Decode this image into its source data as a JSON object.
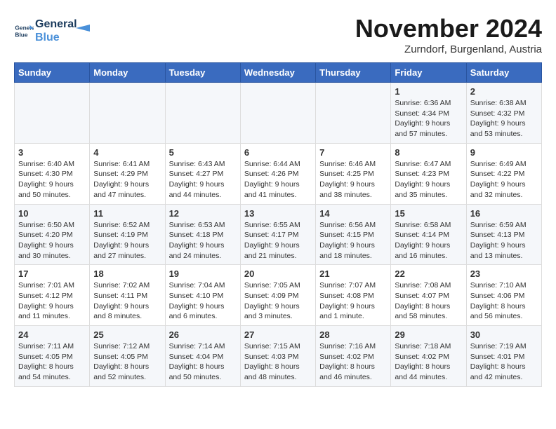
{
  "logo": {
    "line1": "General",
    "line2": "Blue"
  },
  "title": "November 2024",
  "subtitle": "Zurndorf, Burgenland, Austria",
  "days_of_week": [
    "Sunday",
    "Monday",
    "Tuesday",
    "Wednesday",
    "Thursday",
    "Friday",
    "Saturday"
  ],
  "weeks": [
    [
      {
        "day": "",
        "info": ""
      },
      {
        "day": "",
        "info": ""
      },
      {
        "day": "",
        "info": ""
      },
      {
        "day": "",
        "info": ""
      },
      {
        "day": "",
        "info": ""
      },
      {
        "day": "1",
        "info": "Sunrise: 6:36 AM\nSunset: 4:34 PM\nDaylight: 9 hours and 57 minutes."
      },
      {
        "day": "2",
        "info": "Sunrise: 6:38 AM\nSunset: 4:32 PM\nDaylight: 9 hours and 53 minutes."
      }
    ],
    [
      {
        "day": "3",
        "info": "Sunrise: 6:40 AM\nSunset: 4:30 PM\nDaylight: 9 hours and 50 minutes."
      },
      {
        "day": "4",
        "info": "Sunrise: 6:41 AM\nSunset: 4:29 PM\nDaylight: 9 hours and 47 minutes."
      },
      {
        "day": "5",
        "info": "Sunrise: 6:43 AM\nSunset: 4:27 PM\nDaylight: 9 hours and 44 minutes."
      },
      {
        "day": "6",
        "info": "Sunrise: 6:44 AM\nSunset: 4:26 PM\nDaylight: 9 hours and 41 minutes."
      },
      {
        "day": "7",
        "info": "Sunrise: 6:46 AM\nSunset: 4:25 PM\nDaylight: 9 hours and 38 minutes."
      },
      {
        "day": "8",
        "info": "Sunrise: 6:47 AM\nSunset: 4:23 PM\nDaylight: 9 hours and 35 minutes."
      },
      {
        "day": "9",
        "info": "Sunrise: 6:49 AM\nSunset: 4:22 PM\nDaylight: 9 hours and 32 minutes."
      }
    ],
    [
      {
        "day": "10",
        "info": "Sunrise: 6:50 AM\nSunset: 4:20 PM\nDaylight: 9 hours and 30 minutes."
      },
      {
        "day": "11",
        "info": "Sunrise: 6:52 AM\nSunset: 4:19 PM\nDaylight: 9 hours and 27 minutes."
      },
      {
        "day": "12",
        "info": "Sunrise: 6:53 AM\nSunset: 4:18 PM\nDaylight: 9 hours and 24 minutes."
      },
      {
        "day": "13",
        "info": "Sunrise: 6:55 AM\nSunset: 4:17 PM\nDaylight: 9 hours and 21 minutes."
      },
      {
        "day": "14",
        "info": "Sunrise: 6:56 AM\nSunset: 4:15 PM\nDaylight: 9 hours and 18 minutes."
      },
      {
        "day": "15",
        "info": "Sunrise: 6:58 AM\nSunset: 4:14 PM\nDaylight: 9 hours and 16 minutes."
      },
      {
        "day": "16",
        "info": "Sunrise: 6:59 AM\nSunset: 4:13 PM\nDaylight: 9 hours and 13 minutes."
      }
    ],
    [
      {
        "day": "17",
        "info": "Sunrise: 7:01 AM\nSunset: 4:12 PM\nDaylight: 9 hours and 11 minutes."
      },
      {
        "day": "18",
        "info": "Sunrise: 7:02 AM\nSunset: 4:11 PM\nDaylight: 9 hours and 8 minutes."
      },
      {
        "day": "19",
        "info": "Sunrise: 7:04 AM\nSunset: 4:10 PM\nDaylight: 9 hours and 6 minutes."
      },
      {
        "day": "20",
        "info": "Sunrise: 7:05 AM\nSunset: 4:09 PM\nDaylight: 9 hours and 3 minutes."
      },
      {
        "day": "21",
        "info": "Sunrise: 7:07 AM\nSunset: 4:08 PM\nDaylight: 9 hours and 1 minute."
      },
      {
        "day": "22",
        "info": "Sunrise: 7:08 AM\nSunset: 4:07 PM\nDaylight: 8 hours and 58 minutes."
      },
      {
        "day": "23",
        "info": "Sunrise: 7:10 AM\nSunset: 4:06 PM\nDaylight: 8 hours and 56 minutes."
      }
    ],
    [
      {
        "day": "24",
        "info": "Sunrise: 7:11 AM\nSunset: 4:05 PM\nDaylight: 8 hours and 54 minutes."
      },
      {
        "day": "25",
        "info": "Sunrise: 7:12 AM\nSunset: 4:05 PM\nDaylight: 8 hours and 52 minutes."
      },
      {
        "day": "26",
        "info": "Sunrise: 7:14 AM\nSunset: 4:04 PM\nDaylight: 8 hours and 50 minutes."
      },
      {
        "day": "27",
        "info": "Sunrise: 7:15 AM\nSunset: 4:03 PM\nDaylight: 8 hours and 48 minutes."
      },
      {
        "day": "28",
        "info": "Sunrise: 7:16 AM\nSunset: 4:02 PM\nDaylight: 8 hours and 46 minutes."
      },
      {
        "day": "29",
        "info": "Sunrise: 7:18 AM\nSunset: 4:02 PM\nDaylight: 8 hours and 44 minutes."
      },
      {
        "day": "30",
        "info": "Sunrise: 7:19 AM\nSunset: 4:01 PM\nDaylight: 8 hours and 42 minutes."
      }
    ]
  ]
}
